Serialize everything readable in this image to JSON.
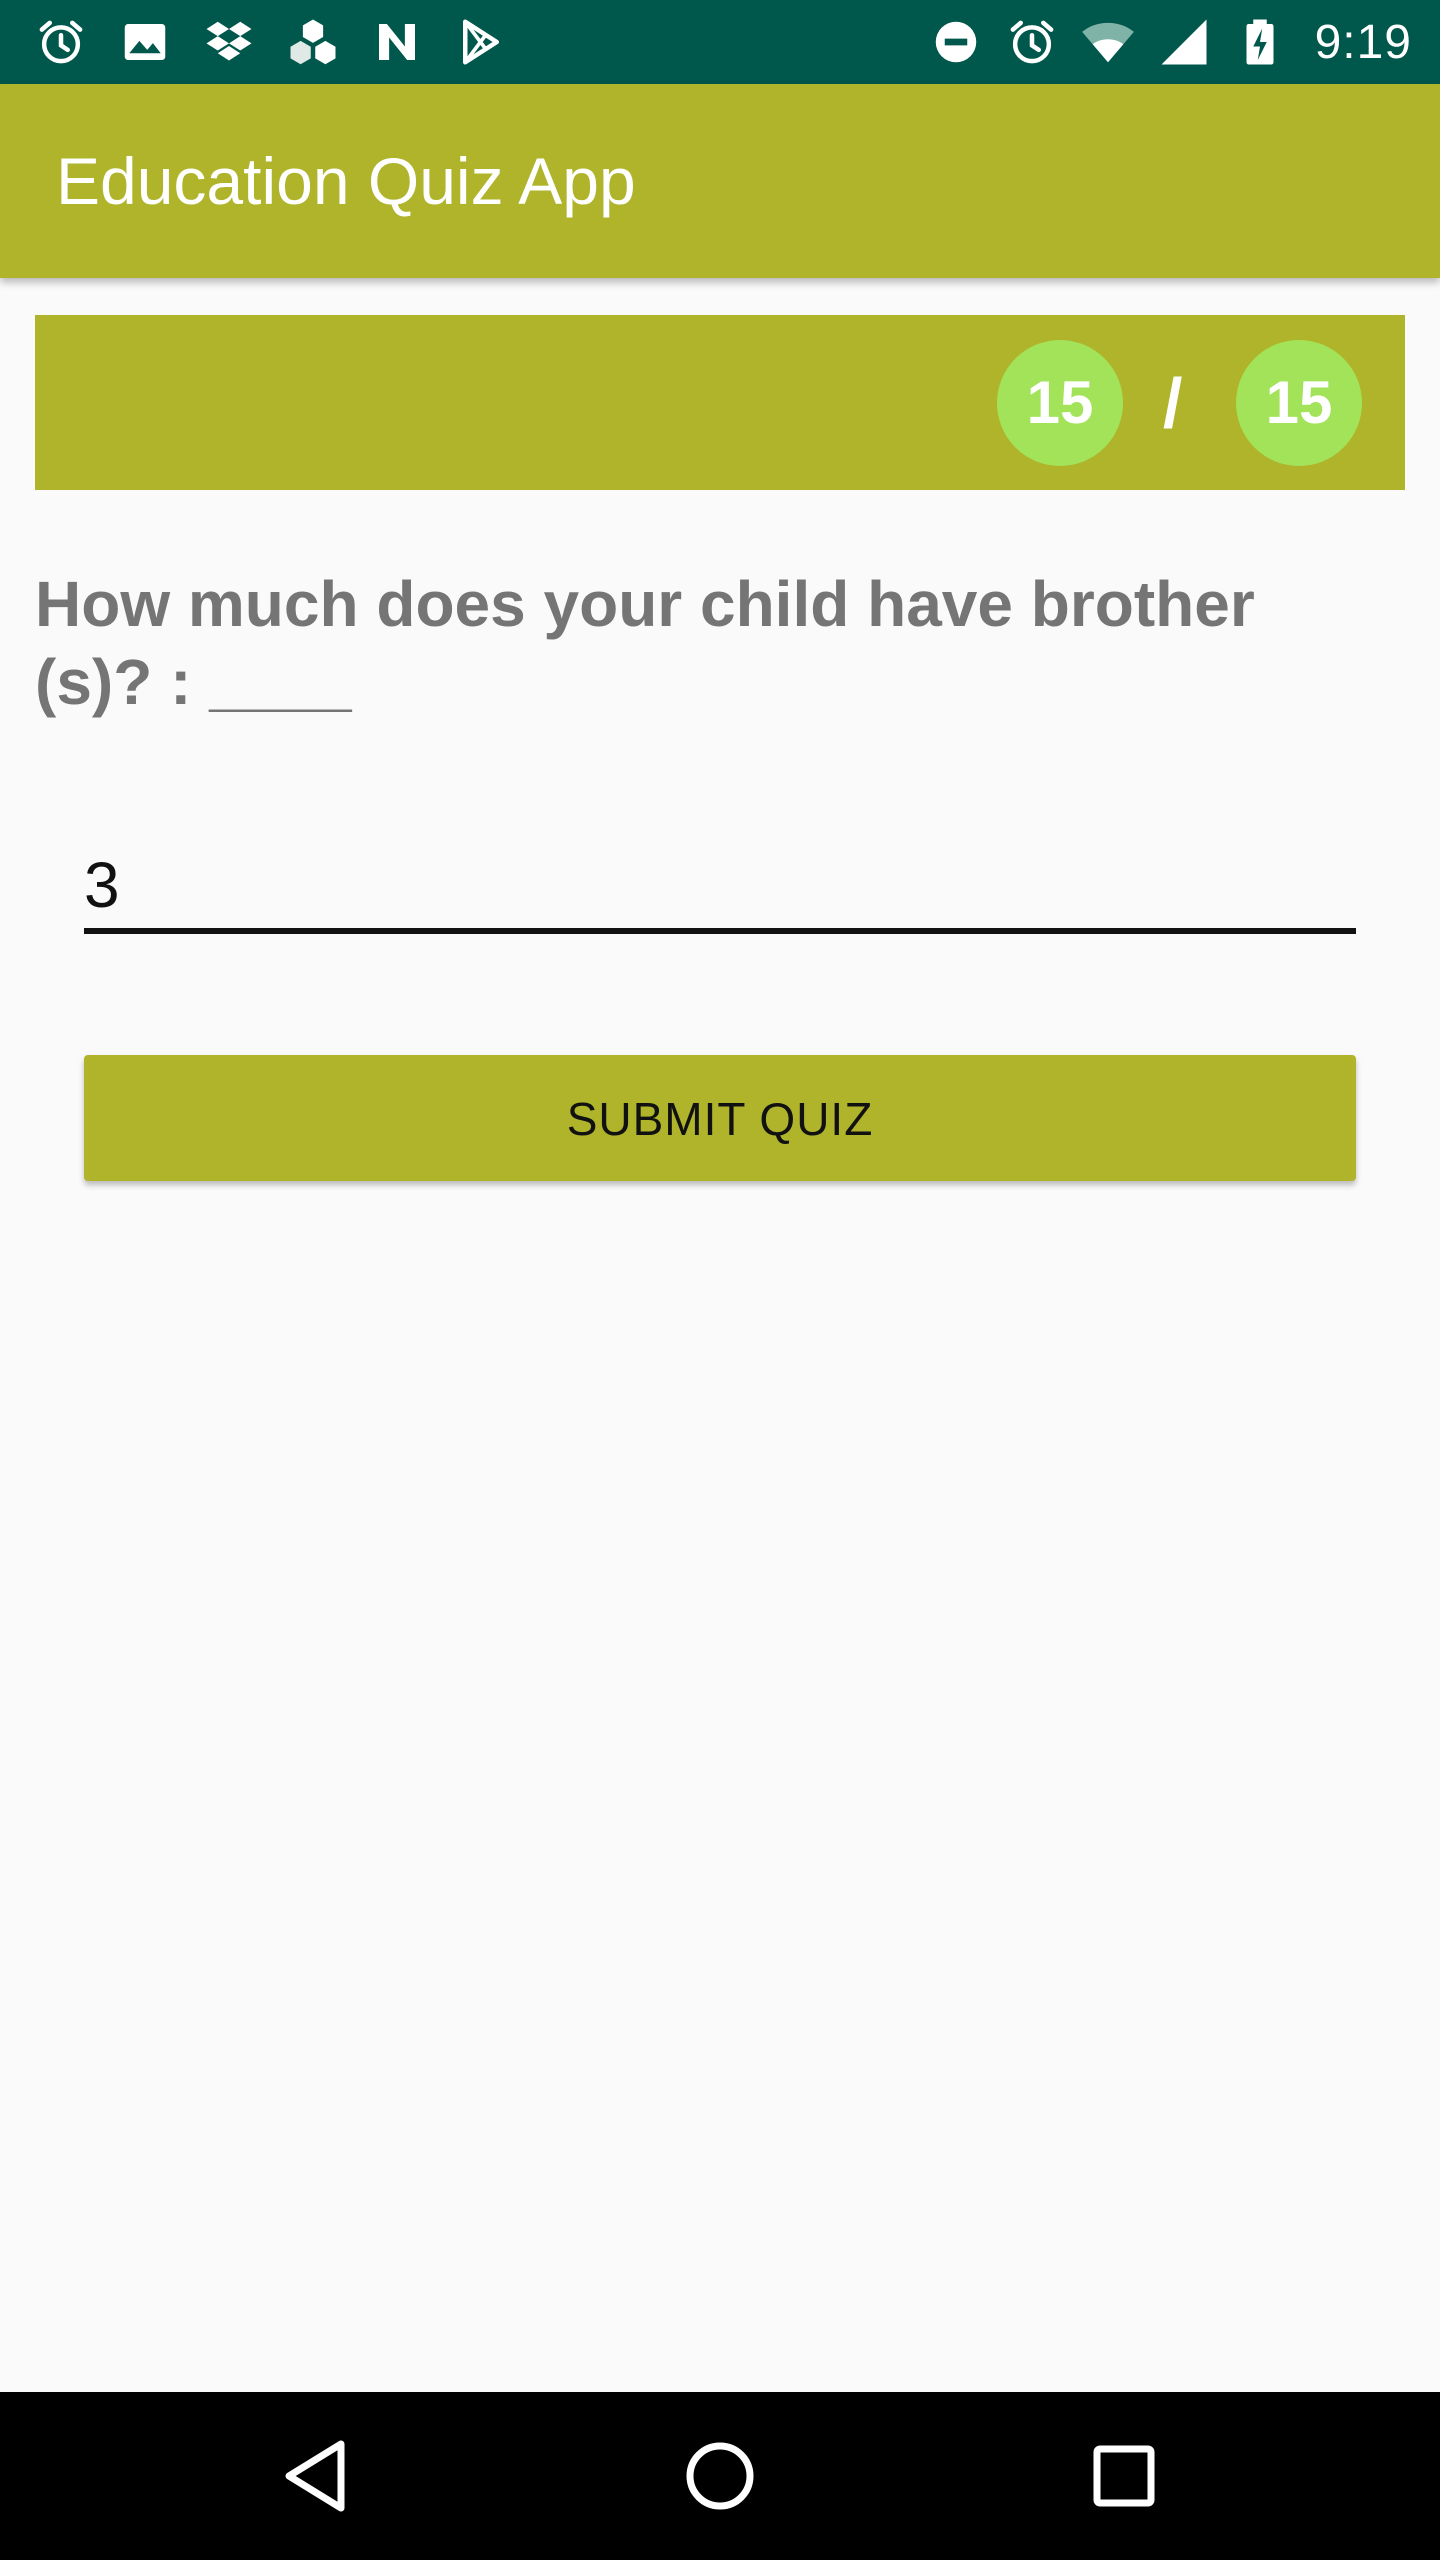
{
  "status_bar": {
    "time": "9:19",
    "left_icons": [
      "alarm-icon",
      "image-icon",
      "dropbox-icon",
      "cubes-icon",
      "n-logo-icon",
      "play-store-icon"
    ],
    "right_icons": [
      "do-not-disturb-icon",
      "alarm-icon",
      "wifi-icon",
      "signal-icon",
      "battery-charging-icon"
    ]
  },
  "app_bar": {
    "title": "Education Quiz App"
  },
  "progress": {
    "current": "15",
    "separator": "/",
    "total": "15"
  },
  "question": {
    "text": "How much does your child have brother (s)? : ____"
  },
  "answer": {
    "value": "3"
  },
  "submit": {
    "label": "SUBMIT QUIZ"
  },
  "nav_bar": {
    "icons": [
      "back-icon",
      "home-icon",
      "recents-icon"
    ]
  },
  "colors": {
    "status_bar": "#00574b",
    "primary": "#afb42b",
    "progress_circle": "#a2e35a",
    "question_text": "#757575",
    "background": "#fafafa"
  }
}
